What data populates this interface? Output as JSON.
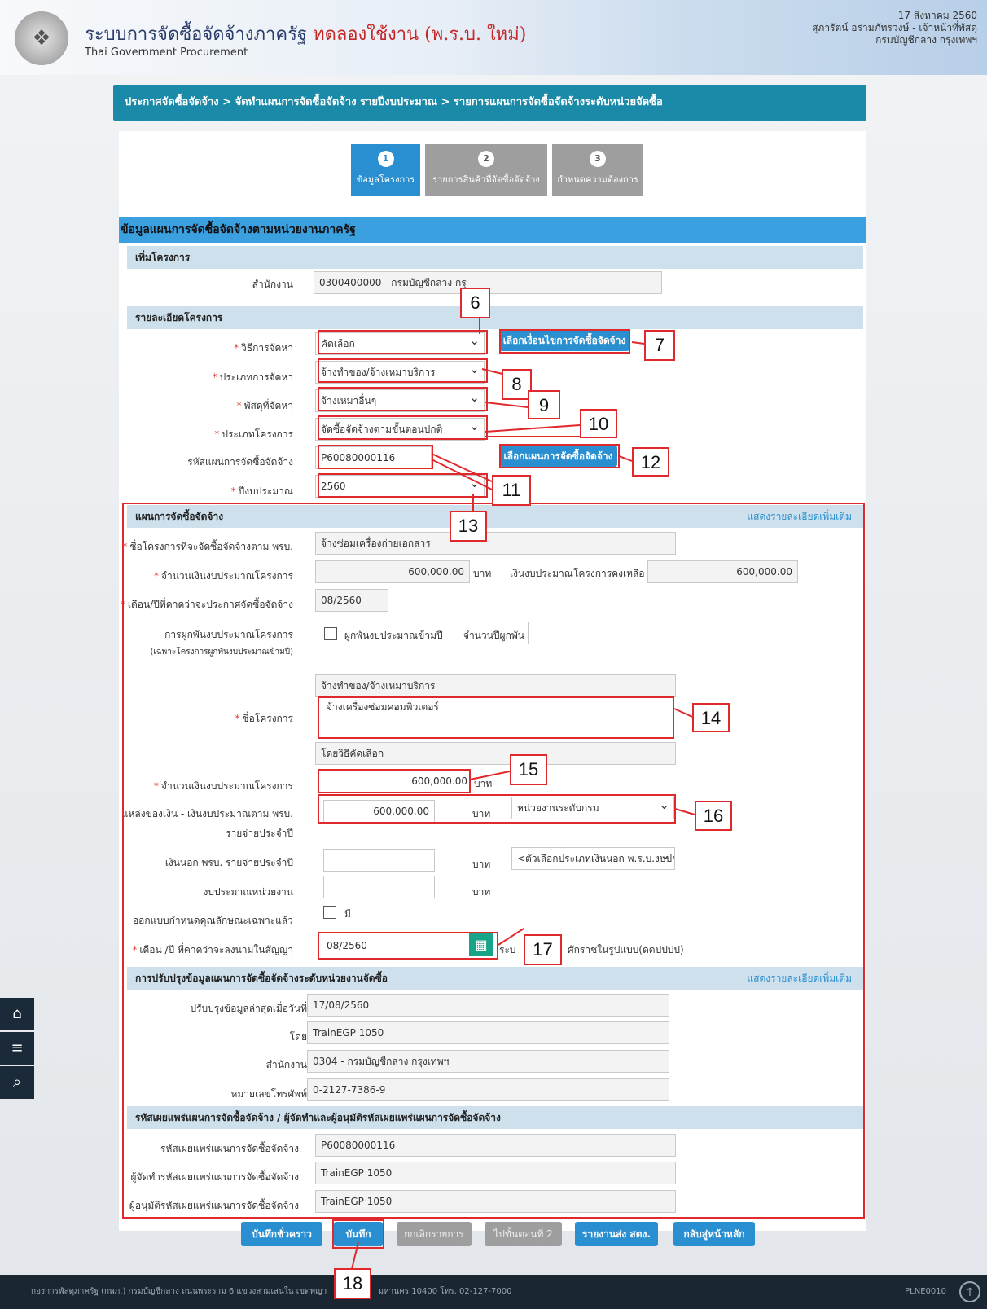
{
  "header": {
    "title_main": "ระบบการจัดซื้อจัดจ้างภาครัฐ",
    "title_trial": "ทดลองใช้งาน (พ.ร.บ. ใหม่)",
    "subtitle": "Thai Government Procurement",
    "date": "17 สิงหาคม 2560",
    "user": "สุภารัตน์ อร่ามภัทรวงษ์ - เจ้าหน้าที่พัสดุ",
    "org": "กรมบัญชีกลาง กรุงเทพฯ"
  },
  "breadcrumb": "ประกาศจัดซื้อจัดจ้าง > จัดทำแผนการจัดซื้อจัดจ้าง รายปีงบประมาณ > รายการแผนการจัดซื้อจัดจ้างระดับหน่วยจัดซื้อ",
  "steps": [
    {
      "num": "1",
      "label": "ข้อมูลโครงการ"
    },
    {
      "num": "2",
      "label": "รายการสินค้าที่จัดซื้อจัดจ้าง"
    },
    {
      "num": "3",
      "label": "กำหนดความต้องการ"
    }
  ],
  "section_title": "ข้อมูลแผนการจัดซื้อจัดจ้างตามหน่วยงานภาครัฐ",
  "add_project": {
    "heading": "เพิ่มโครงการ",
    "office_label": "สำนักงาน",
    "office_value": "0300400000 - กรมบัญชีกลาง กรุ"
  },
  "project_detail": {
    "heading": "รายละเอียดโครงการ",
    "method_label": "วิธีการจัดหา",
    "method_value": "คัดเลือก",
    "condition_button": "เลือกเงื่อนไขการจัดซื้อจัดจ้าง",
    "type_label": "ประเภทการจัดหา",
    "type_value": "จ้างทำของ/จ้างเหมาบริการ",
    "supply_label": "พัสดุที่จัดหา",
    "supply_value": "จ้างเหมาอื่นๆ",
    "project_type_label": "ประเภทโครงการ",
    "project_type_value": "จัดซื้อจัดจ้างตามขั้นตอนปกติ",
    "plan_code_label": "รหัสแผนการจัดซื้อจัดจ้าง",
    "plan_code_value": "P60080000116",
    "plan_button": "เลือกแผนการจัดซื้อจัดจ้าง",
    "fiscal_year_label": "ปีงบประมาณ",
    "fiscal_year_value": "2560"
  },
  "plan": {
    "heading": "แผนการจัดซื้อจัดจ้าง",
    "more_link": "แสดงรายละเอียดเพิ่มเติม",
    "act_name_label": "ชื่อโครงการที่จะจัดซื้อจัดจ้างตาม พรบ.",
    "act_name_value": "จ้างซ่อมเครื่องถ่ายเอกสาร",
    "budget_label": "จำนวนเงินงบประมาณโครงการ",
    "budget_value": "600,000.00",
    "unit_baht": "บาท",
    "remaining_label": "เงินงบประมาณโครงการคงเหลือ",
    "remaining_value": "600,000.00",
    "announce_label": "เดือน/ปีที่คาดว่าจะประกาศจัดซื้อจัดจ้าง",
    "announce_value": "08/2560",
    "commit_label": "การผูกพันงบประมาณโครงการ",
    "commit_note": "(เฉพาะโครงการผูกพันงบประมาณข้ามปี)",
    "commit_check_label": "ผูกพันงบประมาณข้ามปี",
    "commit_years_label": "จำนวนปีผูกพัน",
    "name_prefix": "จ้างทำของ/จ้างเหมาบริการ",
    "name_label": "ชื่อโครงการ",
    "name_value": "จ้างเครื่องซ่อมคอมพิวเตอร์",
    "name_suffix": "โดยวิธีคัดเลือก",
    "budget2_label": "จำนวนเงินงบประมาณโครงการ",
    "budget2_value": "600,000.00",
    "source_label_1": "แหล่งของเงิน - เงินงบประมาณตาม พรบ.",
    "source_label_2": "รายจ่ายประจำปี",
    "source_value": "600,000.00",
    "source_select": "หน่วยงานระดับกรม",
    "offbudget_label": "เงินนอก พรบ. รายจ่ายประจำปี",
    "offbudget_select": "<ตัวเลือกประเภทเงินนอก พ.ร.บ.งบปร",
    "unit_budget_label": "งบประมาณหน่วยงาน",
    "spec_label": "ออกแบบกำหนดคุณลักษณะเฉพาะแล้ว",
    "spec_check_label": "มี",
    "contract_label": "เดือน /ปี ที่คาดว่าจะลงนามในสัญญา",
    "contract_value": "08/2560",
    "contract_hint_1": "ระบ",
    "contract_hint_2": "ศักราชในรูปแบบ(ดดปปปป)"
  },
  "update": {
    "heading": "การปรับปรุงข้อมูลแผนการจัดซื้อจัดจ้างระดับหน่วยงานจัดซื้อ",
    "more_link": "แสดงรายละเอียดเพิ่มเติม",
    "date_label": "ปรับปรุงข้อมูลล่าสุดเมื่อวันที่",
    "date_value": "17/08/2560",
    "by_label": "โดย",
    "by_value": "TrainEGP 1050",
    "office_label": "สำนักงาน",
    "office_value": "0304 - กรมบัญชีกลาง กรุงเทพฯ",
    "phone_label": "หมายเลขโทรศัพท์",
    "phone_value": "0-2127-7386-9"
  },
  "publish": {
    "heading": "รหัสเผยแพร่แผนการจัดซื้อจัดจ้าง / ผู้จัดทำและผู้อนุมัติรหัสเผยแพร่แผนการจัดซื้อจัดจ้าง",
    "code_label": "รหัสเผยแพร่แผนการจัดซื้อจัดจ้าง",
    "code_value": "P60080000116",
    "maker_label": "ผู้จัดทำรหัสเผยแพร่แผนการจัดซื้อจัดจ้าง",
    "maker_value": "TrainEGP 1050",
    "approver_label": "ผู้อนุมัติรหัสเผยแพร่แผนการจัดซื้อจัดจ้าง",
    "approver_value": "TrainEGP 1050"
  },
  "buttons": {
    "draft": "บันทึกชั่วคราว",
    "save": "บันทึก",
    "cancel": "ยกเลิกรายการ",
    "next": "ไปขั้นตอนที่ 2",
    "report": "รายงานส่ง สตง.",
    "home": "กลับสู่หน้าหลัก"
  },
  "callouts": [
    "6",
    "7",
    "8",
    "9",
    "10",
    "11",
    "12",
    "13",
    "14",
    "15",
    "16",
    "17",
    "18"
  ],
  "footer": {
    "address": "กองการพัสดุภาครัฐ (กพภ.) กรมบัญชีกลาง ถนนพระราม 6 แขวงสามเสนใน เขตพญา",
    "address_2": "มหานคร 10400 โทร. 02-127-7000",
    "code": "PLNE0010"
  },
  "icons": {
    "home": "home-icon",
    "menu": "menu-icon",
    "search": "search-icon",
    "calendar": "calendar-icon",
    "scroll_top": "arrow-up-icon"
  },
  "colors": {
    "breadcrumb": "#1a8aa8",
    "primary": "#2a8fd0",
    "annotation": "#e0292c",
    "required": "#e53935"
  }
}
